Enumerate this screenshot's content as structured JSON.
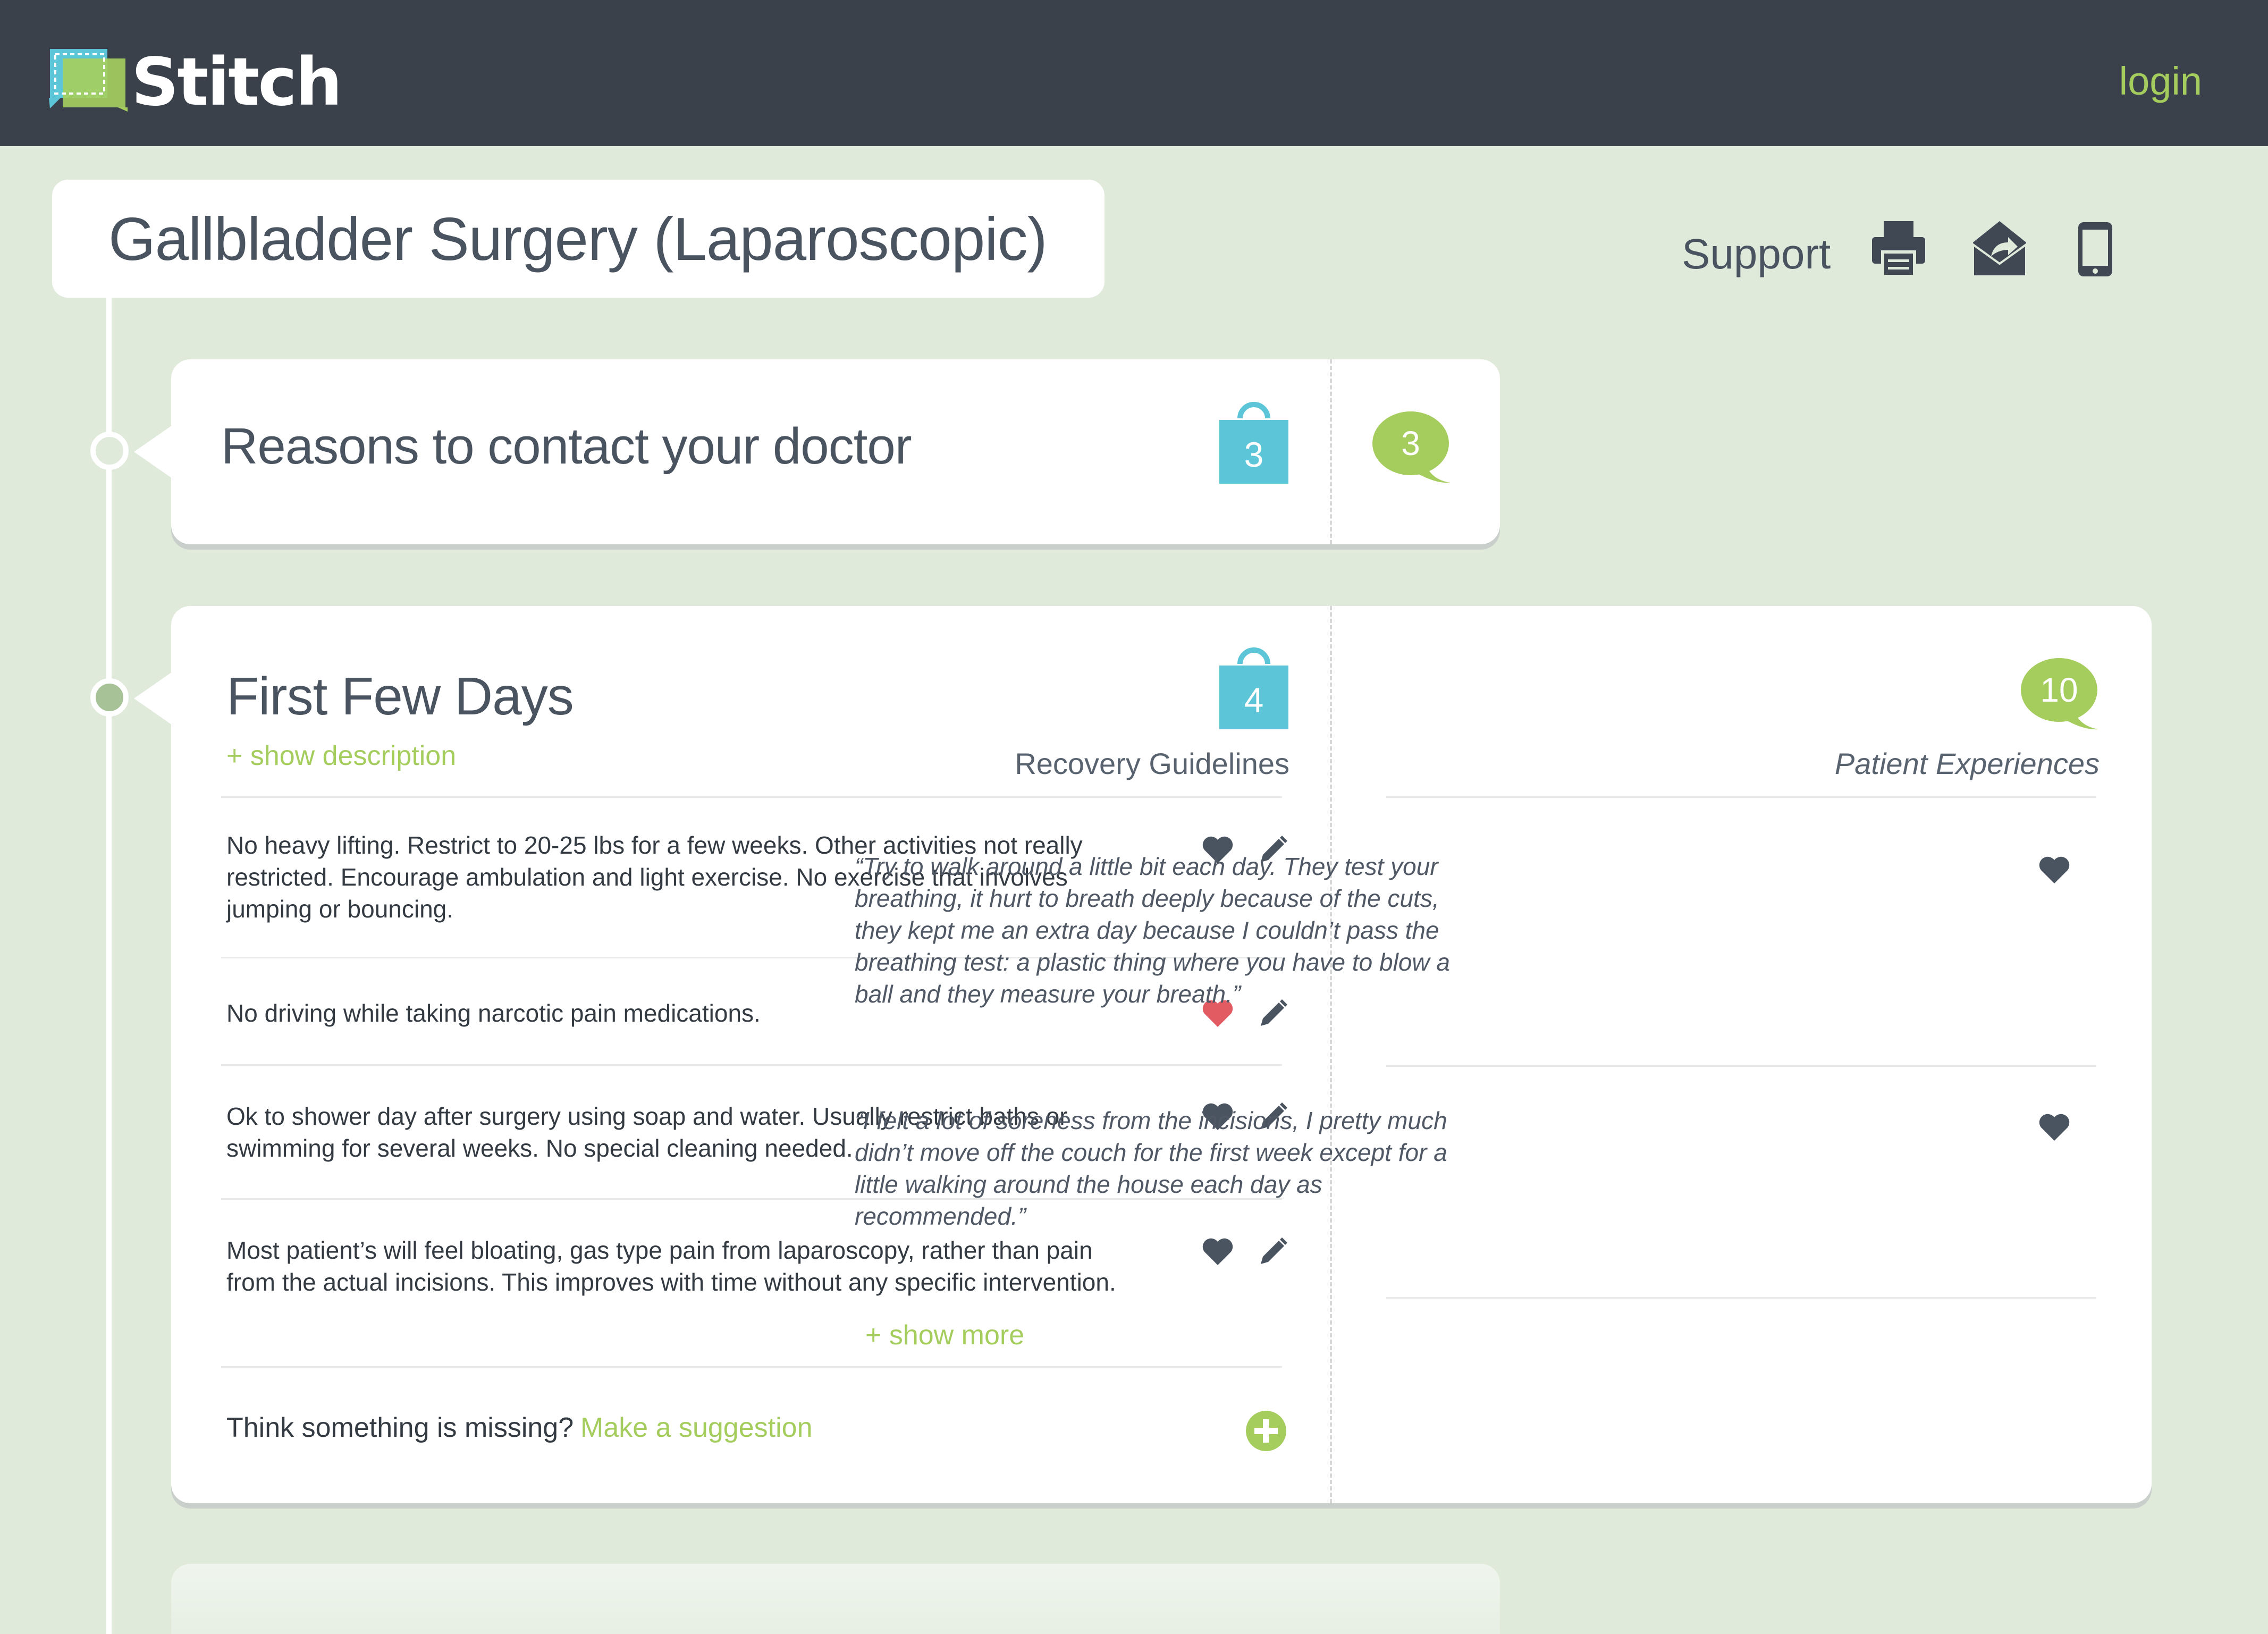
{
  "header": {
    "brand": "Stitch",
    "login_label": "login"
  },
  "page": {
    "title": "Gallbladder Surgery (Laparoscopic)"
  },
  "toolbar": {
    "support_label": "Support",
    "icons": [
      "printer-icon",
      "email-share-icon",
      "mobile-icon"
    ]
  },
  "sections": [
    {
      "title": "Reasons to contact your doctor",
      "guideline_count": "3",
      "experience_count": "3"
    },
    {
      "title": "First Few Days",
      "show_description": "+ show description",
      "guideline_count": "4",
      "experience_count": "10",
      "guidelines_label": "Recovery Guidelines",
      "experiences_label": "Patient Experiences",
      "guidelines": [
        {
          "text": "No heavy lifting. Restrict to 20-25 lbs for a few weeks. Other activities not really restricted. Encourage ambulation and light exercise. No exercise that involves jumping or bouncing.",
          "liked": false
        },
        {
          "text": "No driving while taking narcotic pain medications.",
          "liked": true
        },
        {
          "text": "Ok to shower day after surgery using soap and water. Usually restrict baths or swimming for several weeks. No special cleaning needed.",
          "liked": false
        },
        {
          "text": "Most patient’s will feel bloating, gas type pain from laparoscopy, rather than pain from the actual incisions. This improves with time without any specific intervention.",
          "liked": false
        }
      ],
      "experiences": [
        {
          "text": "“Try to walk around a little bit each day. They test your breathing, it hurt to breath deeply because of the cuts, they kept me an extra day because I couldn’t pass the breathing test: a plastic thing where you have to blow a ball and they measure your breath.”"
        },
        {
          "text": "“I felt a lot of soreness from the incisions, I pretty much didn’t move off the couch for the first week except for a little walking around the house each day as recommended.”"
        }
      ],
      "show_more": "+ show more",
      "missing_prompt": "Think something is missing?",
      "suggest_link": "Make a suggestion"
    }
  ],
  "colors": {
    "accent_green": "#a5cd5e",
    "accent_blue": "#5cc6d8",
    "heart_active": "#e25b63",
    "topbar": "#3a414a",
    "background": "#dfeadb"
  }
}
